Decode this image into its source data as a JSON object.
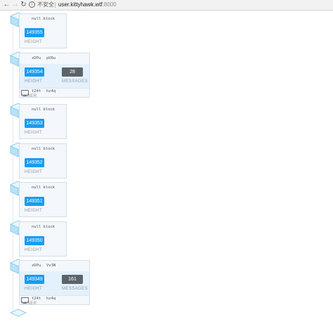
{
  "browser": {
    "security_label": "不安全",
    "url_host": "user.kittyhawk.wtf",
    "url_port": ":8000",
    "icons": {
      "back": "back-arrow-icon",
      "forward": "forward-arrow-icon",
      "reload": "reload-icon",
      "info": "info-icon"
    }
  },
  "labels": {
    "height": "HEIGHT",
    "messages": "MESSAGES",
    "miner": "MINER"
  },
  "blocks": [
    {
      "height": "149355",
      "null_block": "null block"
    },
    {
      "height": "149354",
      "addr_a": "zDPu",
      "addr_b": "pU6u",
      "messages": "28",
      "miner_a": "t24t",
      "miner_b": "hz4q"
    },
    {
      "height": "149353",
      "null_block": "null block"
    },
    {
      "height": "149352",
      "null_block": "null block"
    },
    {
      "height": "149351",
      "null_block": "null block"
    },
    {
      "height": "149350",
      "null_block": "null block"
    },
    {
      "height": "149349",
      "addr_a": "zDPu",
      "addr_b": "Vv3N",
      "messages": "161",
      "miner_a": "t24t",
      "miner_b": "hz4q"
    }
  ]
}
